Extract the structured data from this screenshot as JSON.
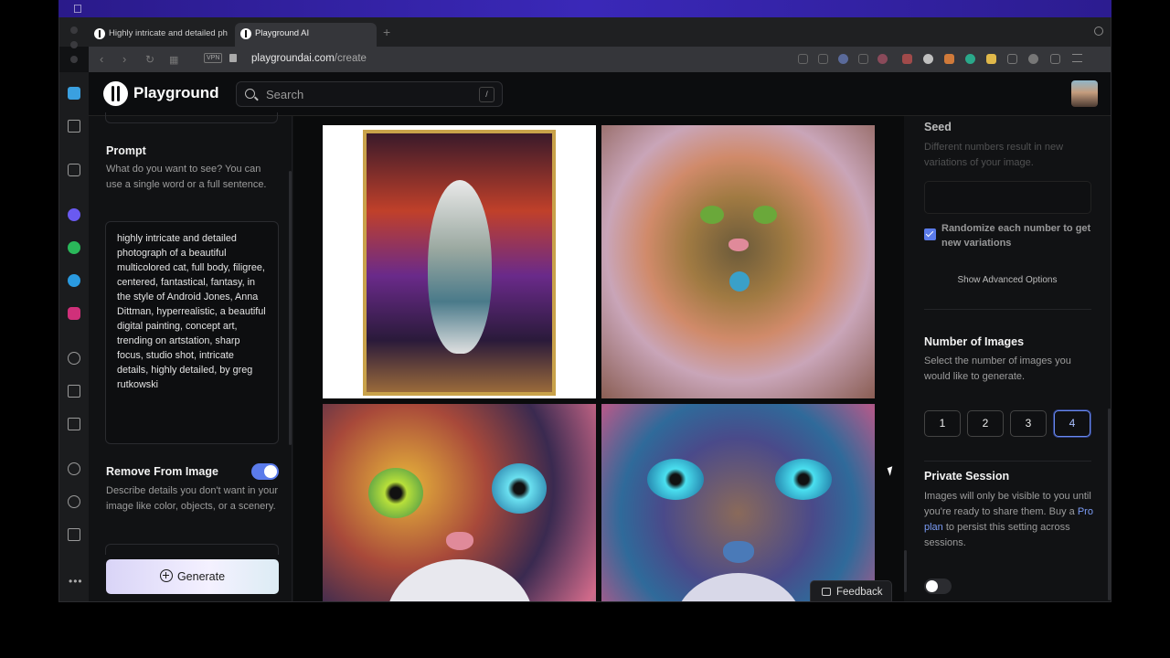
{
  "browser": {
    "tabs": [
      {
        "label": "Highly intricate and detailed ph"
      },
      {
        "label": "Playground AI"
      }
    ],
    "new_tab": "+",
    "vpn": "VPN",
    "url_host": "playgroundai.com",
    "url_path": "/create"
  },
  "app": {
    "name": "Playground",
    "search_placeholder": "Search",
    "search_shortcut": "/"
  },
  "left_panel": {
    "prompt_heading": "Prompt",
    "prompt_help": "What do you want to see? You can use a single word or a full sentence.",
    "prompt_text": "highly intricate and detailed photograph of a beautiful multicolored cat, full body, filigree, centered, fantastical, fantasy, in the style of Android Jones, Anna Dittman, hyperrealistic, a beautiful digital painting, concept art, trending on artstation, sharp focus, studio shot, intricate details, highly detailed, by greg rutkowski",
    "remove_heading": "Remove From Image",
    "remove_toggle_on": true,
    "remove_help": "Describe details you don't want in your image like color, objects, or a scenery.",
    "generate_label": "Generate"
  },
  "main": {
    "images": [
      {
        "name": "generated-image-1"
      },
      {
        "name": "generated-image-2"
      },
      {
        "name": "generated-image-3"
      },
      {
        "name": "generated-image-4"
      }
    ],
    "feedback_label": "Feedback"
  },
  "right_panel": {
    "seed_heading": "Seed",
    "seed_help": "Different numbers result in new variations of your image.",
    "seed_value": "",
    "randomize_label": "Randomize each number to get new variations",
    "randomize_checked": true,
    "advanced_label": "Show Advanced Options",
    "num_images_heading": "Number of Images",
    "num_images_help": "Select the number of images you would like to generate.",
    "num_options": [
      "1",
      "2",
      "3",
      "4"
    ],
    "num_selected": "4",
    "private_heading": "Private Session",
    "private_help_1": "Images will only be visible to you until you're ready to share them. Buy a ",
    "private_link": "Pro plan",
    "private_help_2": " to persist this setting across sessions.",
    "private_toggle_on": false
  },
  "colors": {
    "accent": "#5b7bea",
    "background": "#111214",
    "mac_menubar": "#3a28b8"
  }
}
